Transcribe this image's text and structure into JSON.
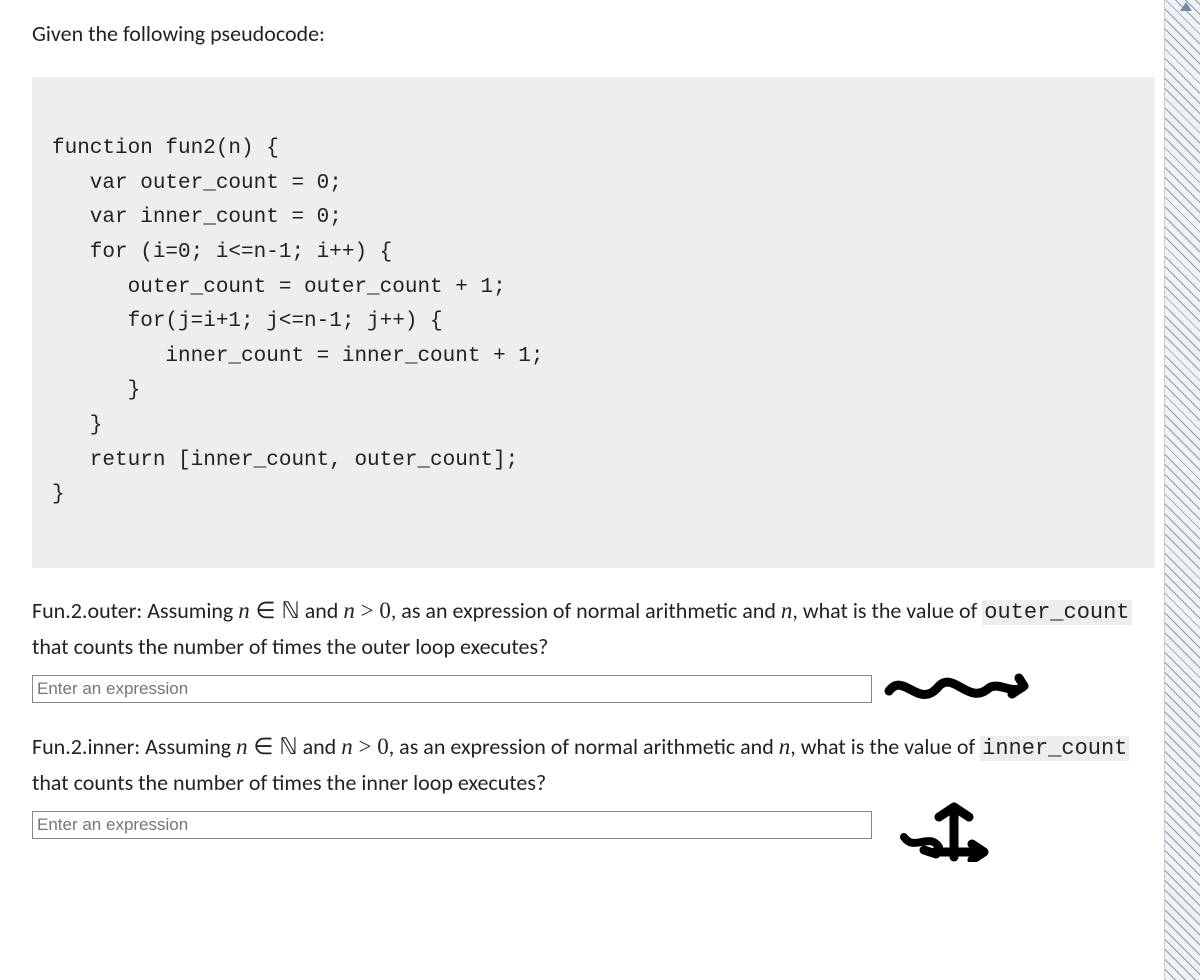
{
  "intro": "Given the following pseudocode:",
  "code": "function fun2(n) {\n   var outer_count = 0;\n   var inner_count = 0;\n   for (i=0; i<=n-1; i++) {\n      outer_count = outer_count + 1;\n      for(j=i+1; j<=n-1; j++) {\n         inner_count = inner_count + 1;\n      }\n   }\n   return [inner_count, outer_count];\n}",
  "q1": {
    "label": "Fun.2.outer:",
    "lead": " Assuming ",
    "var1": "n",
    "in": " ∈ ",
    "nat": "ℕ",
    "and": " and ",
    "var2": "n",
    "gt": " > ",
    "zero": "0",
    "tail1": ", as an expression of normal arithmetic and ",
    "var3": "n",
    "tail2": ", what is the value of ",
    "code": "outer_count",
    "tail3": " that counts the number of times the outer loop executes?",
    "placeholder": "Enter an expression"
  },
  "q2": {
    "label": "Fun.2.inner:",
    "lead": " Assuming ",
    "var1": "n",
    "in": " ∈ ",
    "nat": "ℕ",
    "and": " and ",
    "var2": "n",
    "gt": " > ",
    "zero": "0",
    "tail1": ", as an expression of normal arithmetic and ",
    "var3": "n",
    "tail2": ", what is the value of ",
    "code": "inner_count",
    "tail3": " that counts the number of times the inner loop executes?",
    "placeholder": "Enter an expression"
  }
}
